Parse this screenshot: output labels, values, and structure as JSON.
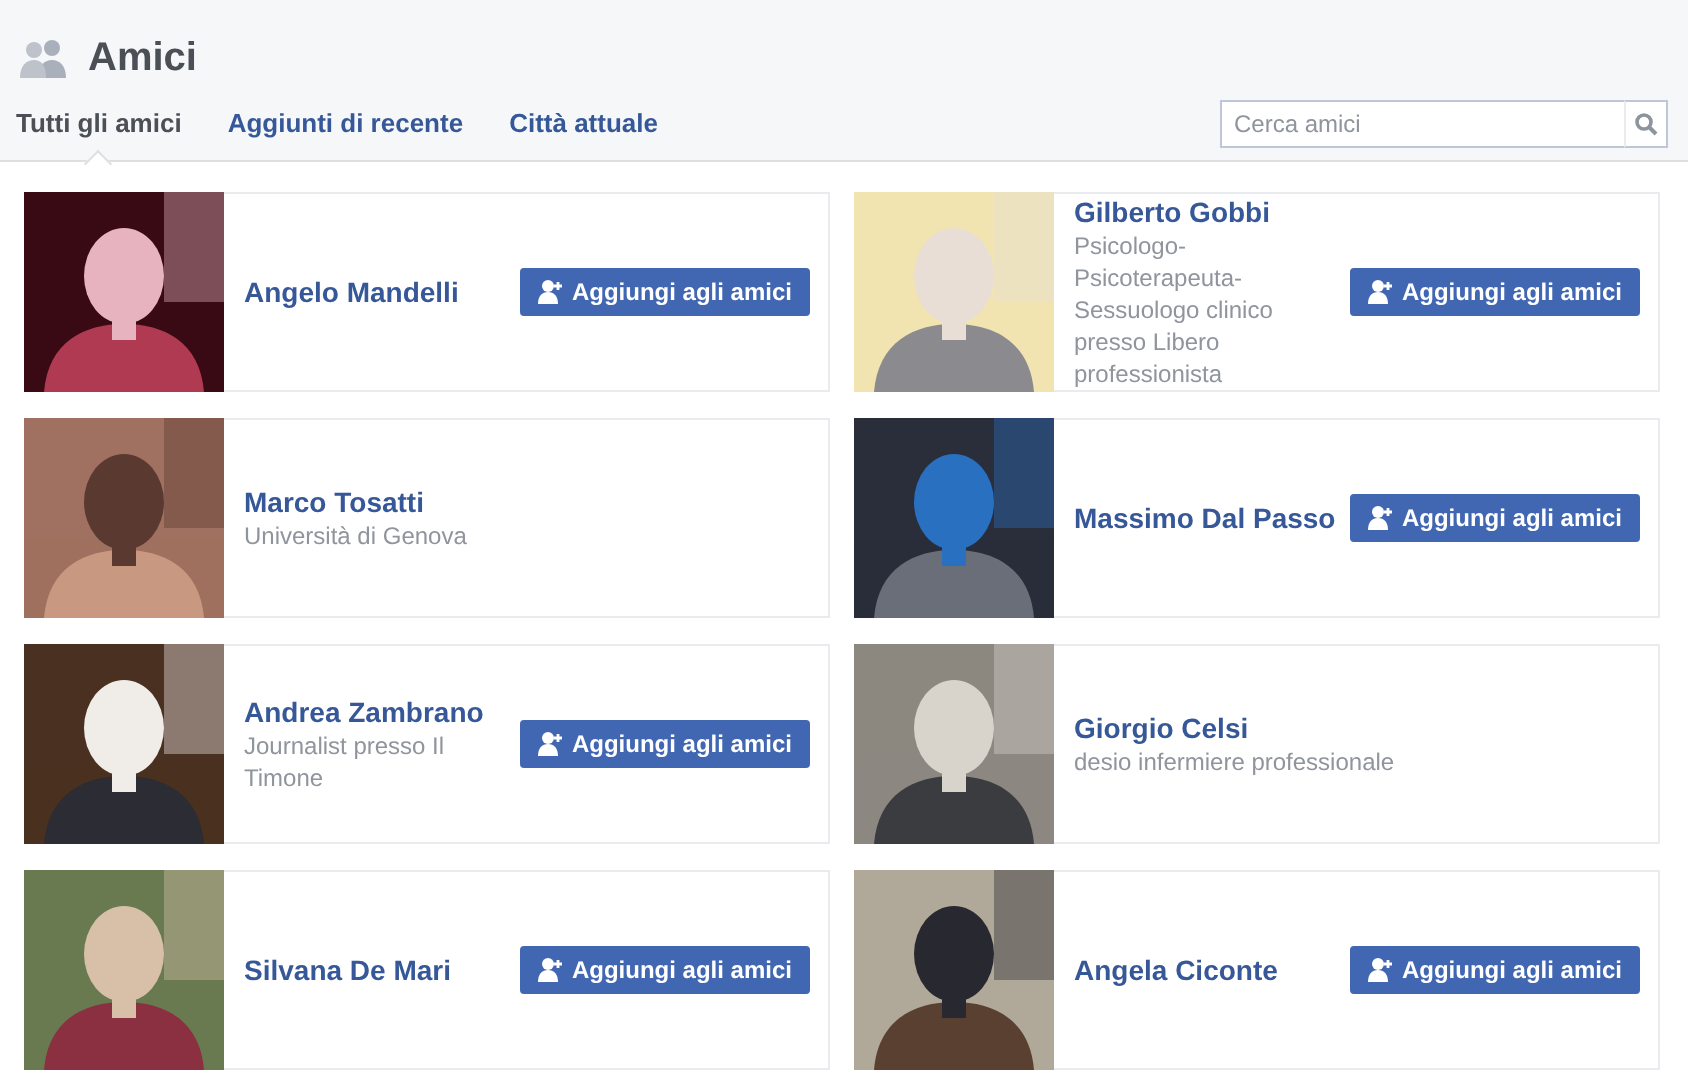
{
  "header": {
    "title": "Amici"
  },
  "tabs": [
    {
      "label": "Tutti gli amici",
      "selected": true
    },
    {
      "label": "Aggiunti di recente",
      "selected": false
    },
    {
      "label": "Città attuale",
      "selected": false
    }
  ],
  "search": {
    "placeholder": "Cerca amici"
  },
  "friend_rows": [
    [
      {
        "name": "Angelo Mandelli",
        "button": "Aggiungi agli amici"
      },
      {
        "name": "Gilberto Gobbi",
        "subtitle": "Psicologo-Psicoterapeuta-Sessuologo clinico presso Libero professionista",
        "button": "Aggiungi agli amici"
      }
    ],
    [
      {
        "name": "Marco Tosatti",
        "subtitle": "Università di Genova"
      },
      {
        "name": "Massimo Dal Passo",
        "button": "Aggiungi agli amici"
      }
    ],
    [
      {
        "name": "Andrea Zambrano",
        "subtitle": "Journalist presso Il Timone",
        "button": "Aggiungi agli amici"
      },
      {
        "name": "Giorgio Celsi",
        "subtitle": "desio infermiere professionale"
      }
    ],
    [
      {
        "name": "Silvana De Mari",
        "button": "Aggiungi agli amici"
      },
      {
        "name": "Angela Ciconte",
        "button": "Aggiungi agli amici"
      }
    ]
  ]
}
